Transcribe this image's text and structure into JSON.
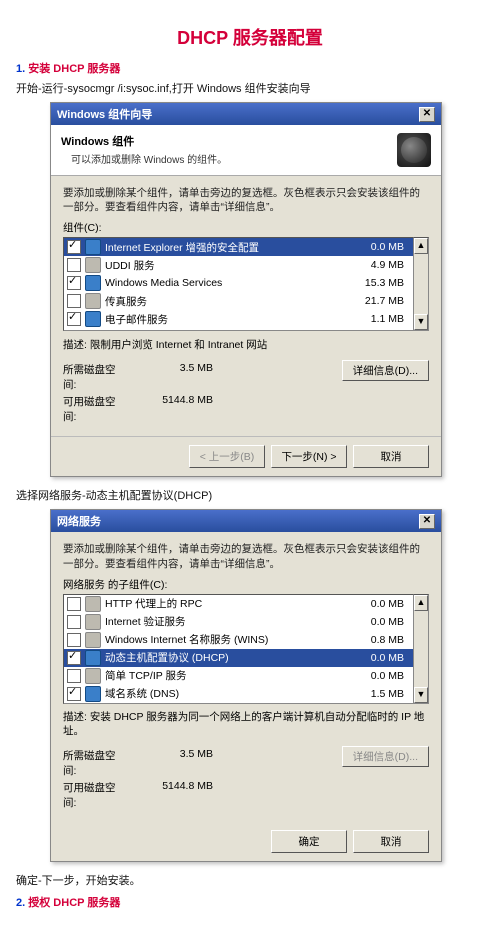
{
  "title": "DHCP 服务器配置",
  "section1": {
    "num": "1.",
    "title": "安装 DHCP 服务器"
  },
  "line1": "开始-运行-sysocmgr /i:sysoc.inf,打开 Windows 组件安装向导",
  "dialog1": {
    "title": "Windows 组件向导",
    "bannerTitle": "Windows 组件",
    "bannerSub": "可以添加或删除 Windows 的组件。",
    "instr": "要添加或删除某个组件，请单击旁边的复选框。灰色框表示只会安装该组件的一部分。要查看组件内容，请单击“详细信息”。",
    "groupLabel": "组件(C):",
    "rows": [
      {
        "checked": true,
        "sel": true,
        "label": "Internet Explorer 增强的安全配置",
        "size": "0.0 MB"
      },
      {
        "checked": false,
        "sel": false,
        "label": "UDDI 服务",
        "size": "4.9 MB"
      },
      {
        "checked": true,
        "sel": false,
        "label": "Windows Media Services",
        "size": "15.3 MB"
      },
      {
        "checked": false,
        "sel": false,
        "label": "传真服务",
        "size": "21.7 MB"
      },
      {
        "checked": true,
        "sel": false,
        "label": "电子邮件服务",
        "size": "1.1 MB"
      }
    ],
    "desc": "描述:    限制用户浏览 Internet 和 Intranet 网站",
    "diskReqLabel": "所需磁盘空间:",
    "diskReqVal": "3.5 MB",
    "diskAvlLabel": "可用磁盘空间:",
    "diskAvlVal": "5144.8 MB",
    "detailsBtn": "详细信息(D)...",
    "backBtn": "< 上一步(B)",
    "nextBtn": "下一步(N) >",
    "cancelBtn": "取消"
  },
  "line2": "选择网络服务-动态主机配置协议(DHCP)",
  "dialog2": {
    "title": "网络服务",
    "instr": "要添加或删除某个组件，请单击旁边的复选框。灰色框表示只会安装该组件的一部分。要查看组件内容，请单击“详细信息”。",
    "groupLabel": "网络服务 的子组件(C):",
    "rows": [
      {
        "checked": false,
        "sel": false,
        "label": "HTTP 代理上的 RPC",
        "size": "0.0 MB"
      },
      {
        "checked": false,
        "sel": false,
        "label": "Internet 验证服务",
        "size": "0.0 MB"
      },
      {
        "checked": false,
        "sel": false,
        "label": "Windows Internet 名称服务 (WINS)",
        "size": "0.8 MB"
      },
      {
        "checked": true,
        "sel": true,
        "label": "动态主机配置协议 (DHCP)",
        "size": "0.0 MB"
      },
      {
        "checked": false,
        "sel": false,
        "label": "简单 TCP/IP 服务",
        "size": "0.0 MB"
      },
      {
        "checked": true,
        "sel": false,
        "label": "域名系统 (DNS)",
        "size": "1.5 MB"
      }
    ],
    "desc": "描述:  安装 DHCP 服务器为同一个网络上的客户端计算机自动分配临时的 IP 地址。",
    "diskReqLabel": "所需磁盘空间:",
    "diskReqVal": "3.5 MB",
    "diskAvlLabel": "可用磁盘空间:",
    "diskAvlVal": "5144.8 MB",
    "detailsBtn": "详细信息(D)...",
    "okBtn": "确定",
    "cancelBtn": "取消"
  },
  "line3": "确定-下一步，开始安装。",
  "section2": {
    "num": "2.",
    "title": "授权 DHCP 服务器"
  }
}
